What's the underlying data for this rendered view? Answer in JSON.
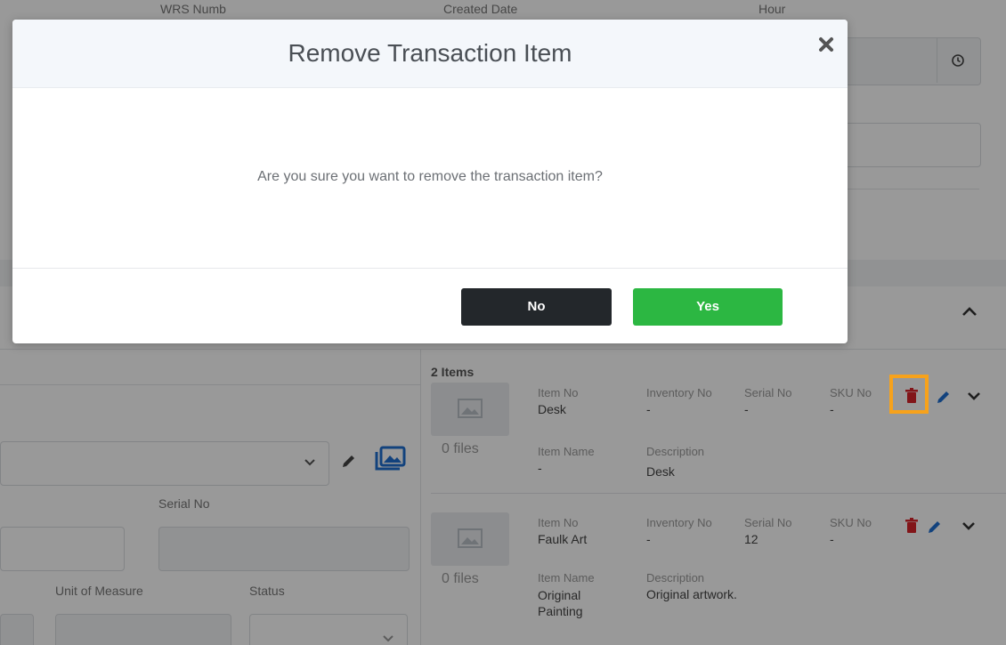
{
  "background": {
    "header": {
      "wrs_number_label": "WRS Numb",
      "created_date_label": "Created Date",
      "hour_label": "Hour"
    },
    "items_header": {
      "count_label": "2 Items"
    },
    "left_form": {
      "serial_no_label": "Serial No",
      "unit_of_measure_label": "Unit of Measure",
      "status_label": "Status"
    },
    "items": [
      {
        "files_label": "0 files",
        "item_no_label": "Item No",
        "item_no": "Desk",
        "inventory_no_label": "Inventory No",
        "inventory_no": "-",
        "serial_no_label": "Serial No",
        "serial_no": "-",
        "sku_no_label": "SKU No",
        "sku_no": "-",
        "item_name_label": "Item Name",
        "item_name": "-",
        "description_label": "Description",
        "description": "Desk"
      },
      {
        "files_label": "0 files",
        "item_no_label": "Item No",
        "item_no": "Faulk Art",
        "inventory_no_label": "Inventory No",
        "inventory_no": "-",
        "serial_no_label": "Serial No",
        "serial_no": "12",
        "sku_no_label": "SKU No",
        "sku_no": "-",
        "item_name_label": "Item Name",
        "item_name": "Original Painting",
        "description_label": "Description",
        "description": "Original artwork."
      }
    ]
  },
  "modal": {
    "title": "Remove Transaction Item",
    "message": "Are you sure you want to remove the transaction item?",
    "no_label": "No",
    "yes_label": "Yes",
    "close_icon": "close-icon"
  },
  "colors": {
    "yes_button": "#2cb742",
    "no_button": "#23272b",
    "delete_icon": "#d9242b",
    "edit_icon": "#1f6fd1",
    "highlight": "#f7a21b"
  }
}
